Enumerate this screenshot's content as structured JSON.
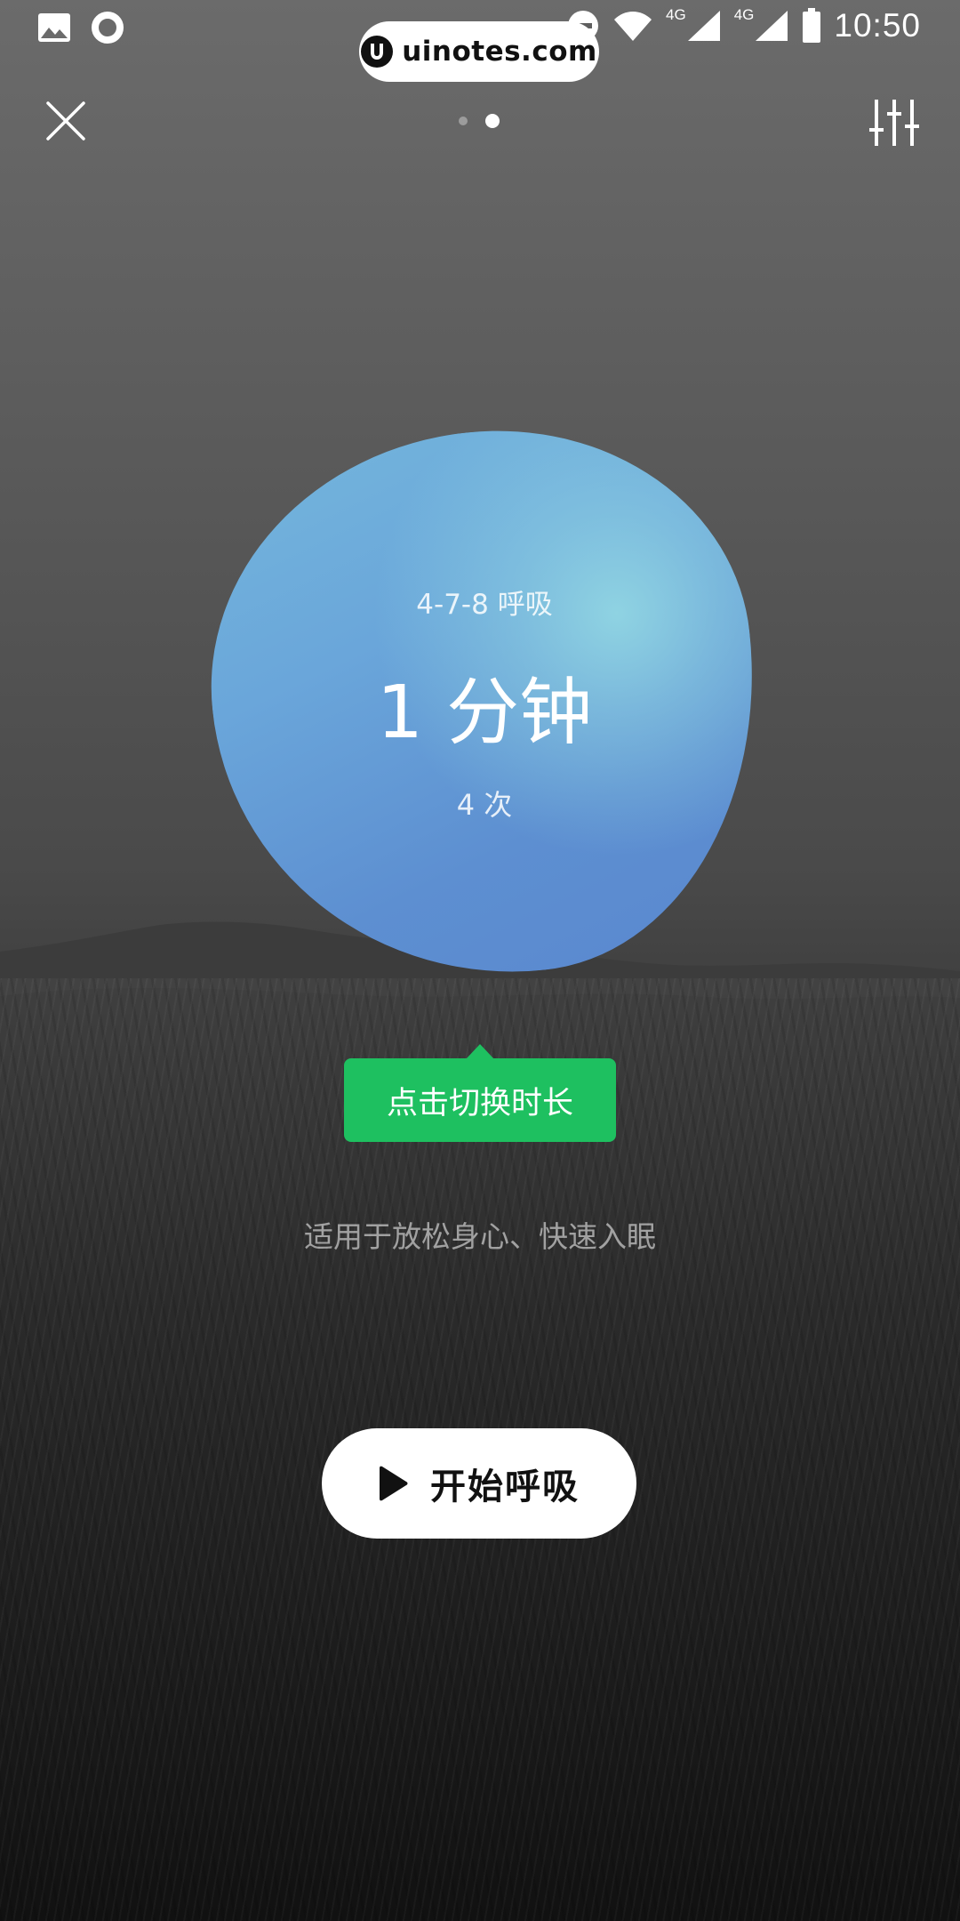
{
  "status_bar": {
    "time": "10:50",
    "network_1": "4G",
    "network_2": "4G"
  },
  "watermark": {
    "text": "uinotes.com"
  },
  "top_bar": {
    "close_icon": "close-icon",
    "settings_icon": "sliders-icon",
    "pages": 2,
    "active_page": 2
  },
  "exercise": {
    "title": "4-7-8 呼吸",
    "duration": "1 分钟",
    "count": "4 次"
  },
  "tooltip": {
    "label": "点击切换时长"
  },
  "description": "适用于放松身心、快速入眠",
  "start_button": {
    "label": "开始呼吸",
    "icon": "play-icon"
  },
  "colors": {
    "accent_green": "#1ec060",
    "blob_blue": "#6aa6da",
    "blob_cyan": "#8fd3e2"
  }
}
